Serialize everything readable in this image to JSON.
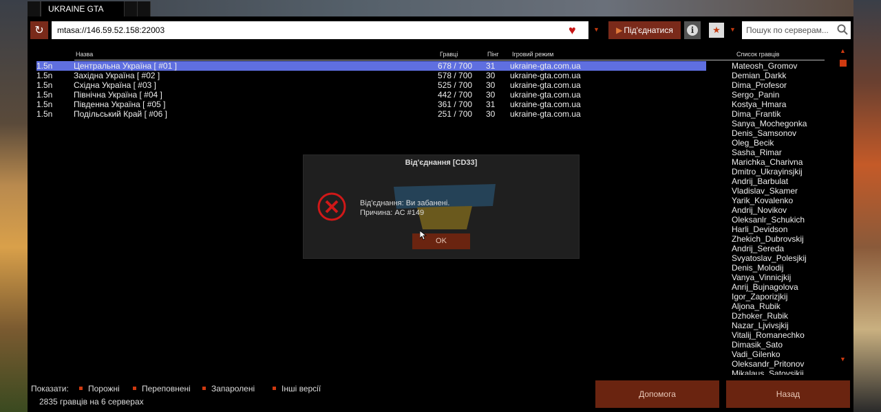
{
  "window": {
    "tab_title": "UKRAINE GTA"
  },
  "toolbar": {
    "address": "mtasa://146.59.52.158:22003",
    "connect_label": "Під'єднатися",
    "search_placeholder": "Пошук по серверам..."
  },
  "server_list": {
    "headers": {
      "name": "Назва",
      "players": "Гравці",
      "ping": "Пінг",
      "gamemode": "Ігровий режим"
    },
    "rows": [
      {
        "version": "1.5n",
        "name": "Центральна Україна [ #01 ]",
        "players": "678 / 700",
        "ping": "31",
        "gamemode": "ukraine-gta.com.ua",
        "selected": true
      },
      {
        "version": "1.5n",
        "name": "Західна Україна [ #02 ]",
        "players": "578 / 700",
        "ping": "30",
        "gamemode": "ukraine-gta.com.ua",
        "selected": false
      },
      {
        "version": "1.5n",
        "name": "Східна Україна [ #03 ]",
        "players": "525 / 700",
        "ping": "30",
        "gamemode": "ukraine-gta.com.ua",
        "selected": false
      },
      {
        "version": "1.5n",
        "name": "Північна Україна [ #04 ]",
        "players": "442 / 700",
        "ping": "30",
        "gamemode": "ukraine-gta.com.ua",
        "selected": false
      },
      {
        "version": "1.5n",
        "name": "Південна Україна [ #05 ]",
        "players": "361 / 700",
        "ping": "31",
        "gamemode": "ukraine-gta.com.ua",
        "selected": false
      },
      {
        "version": "1.5n",
        "name": "Подільський Край [ #06 ]",
        "players": "251 / 700",
        "ping": "30",
        "gamemode": "ukraine-gta.com.ua",
        "selected": false
      }
    ]
  },
  "player_list": {
    "header": "Список гравців",
    "players": [
      "Mateosh_Gromov",
      "Demian_Darkk",
      "Dima_Profesor",
      "Sergo_Panin",
      "Kostya_Hmara",
      "Dima_Frantik",
      "Sanya_Mochegonka",
      "Denis_Samsonov",
      "Oleg_Becik",
      "Sasha_Rimar",
      "Marichka_Charivna",
      "Dmitro_Ukrayinsjkij",
      "Andrij_Barbulat",
      "Vladislav_Skamer",
      "Yarik_Kovalenko",
      "Andrij_Novikov",
      "Oleksanlr_Schukich",
      "Harli_Devidson",
      "Zhekich_Dubrovskij",
      "Andrij_Sereda",
      "Svyatoslav_Polesjkij",
      "Denis_Molodij",
      "Vanya_Vinnicjkij",
      "Anrij_Bujnagolova",
      "Igor_Zaporizjkij",
      "Aljona_Rubik",
      "Dzhoker_Rubik",
      "Nazar_Ljvivsjkij",
      "Vitalij_Romanechko",
      "Dimasik_Sato",
      "Vadi_Gilenko",
      "Oleksandr_Pritonov",
      "Mikalaus_Satovsjkij"
    ]
  },
  "filters": {
    "label": "Показати:",
    "options": [
      "Порожні",
      "Переповнені",
      "Запаролені",
      "Інші версії"
    ]
  },
  "status": {
    "count": "2835 гравців на 6 серверах"
  },
  "buttons": {
    "help": "Допомога",
    "back": "Назад"
  },
  "dialog": {
    "title": "Від'єднання [CD33]",
    "line1": "Від'єднання: Ви забанені.",
    "line2": "Причина: AC #149",
    "ok": "OK"
  },
  "colors": {
    "accent": "#d03a10",
    "button_bg": "#6a2410",
    "selection": "#5f6fe0"
  }
}
